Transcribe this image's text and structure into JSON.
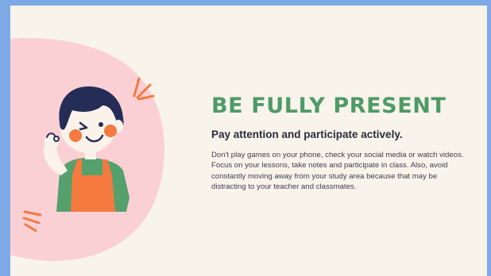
{
  "slide": {
    "title": "BE FULLY PRESENT",
    "subtitle": "Pay attention and participate actively.",
    "body": "Don't play games on your phone, check your social media or watch videos. Focus on your lessons, take notes and participate in class. Also, avoid constantly moving away from your study area because that may be distracting to your teacher and classmates."
  },
  "illustration": {
    "subject": "waving-child",
    "colors": {
      "background": "#f8f4ec",
      "frame": "#7fa8e6",
      "blob": "#fbd0d5",
      "accent_orange": "#f47a3f",
      "shirt_green": "#55a06d",
      "hair": "#252d57",
      "title_green": "#4f9a66"
    }
  }
}
